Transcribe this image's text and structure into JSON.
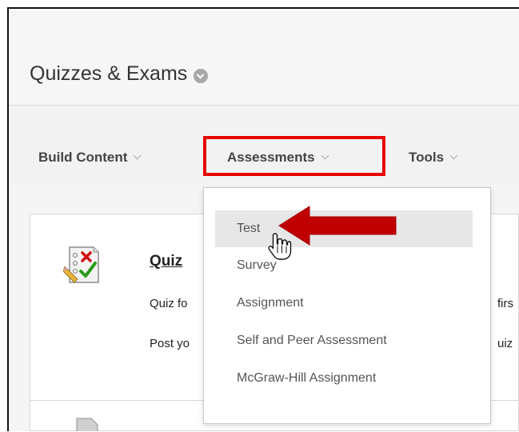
{
  "header": {
    "title": "Quizzes & Exams"
  },
  "toolbar": {
    "build_content": "Build Content",
    "assessments": "Assessments",
    "tools": "Tools"
  },
  "dropdown": {
    "items": [
      {
        "label": "Test",
        "hover": true
      },
      {
        "label": "Survey"
      },
      {
        "label": "Assignment"
      },
      {
        "label": "Self and Peer Assessment"
      },
      {
        "label": "McGraw-Hill Assignment"
      }
    ]
  },
  "content": {
    "quiz_title_visible": "Quiz",
    "desc_line1_left": "Quiz fo",
    "desc_line1_right": "firs",
    "desc_line2_left": "Post yo",
    "desc_line2_right": "uiz"
  },
  "colors": {
    "highlight_border": "#e60000",
    "arrow": "#c00000",
    "hover_bg": "#e7e7e7"
  },
  "icons": {
    "quiz": "test-checklist-icon",
    "cursor": "hand-pointer-icon",
    "arrow": "red-arrow-icon"
  }
}
